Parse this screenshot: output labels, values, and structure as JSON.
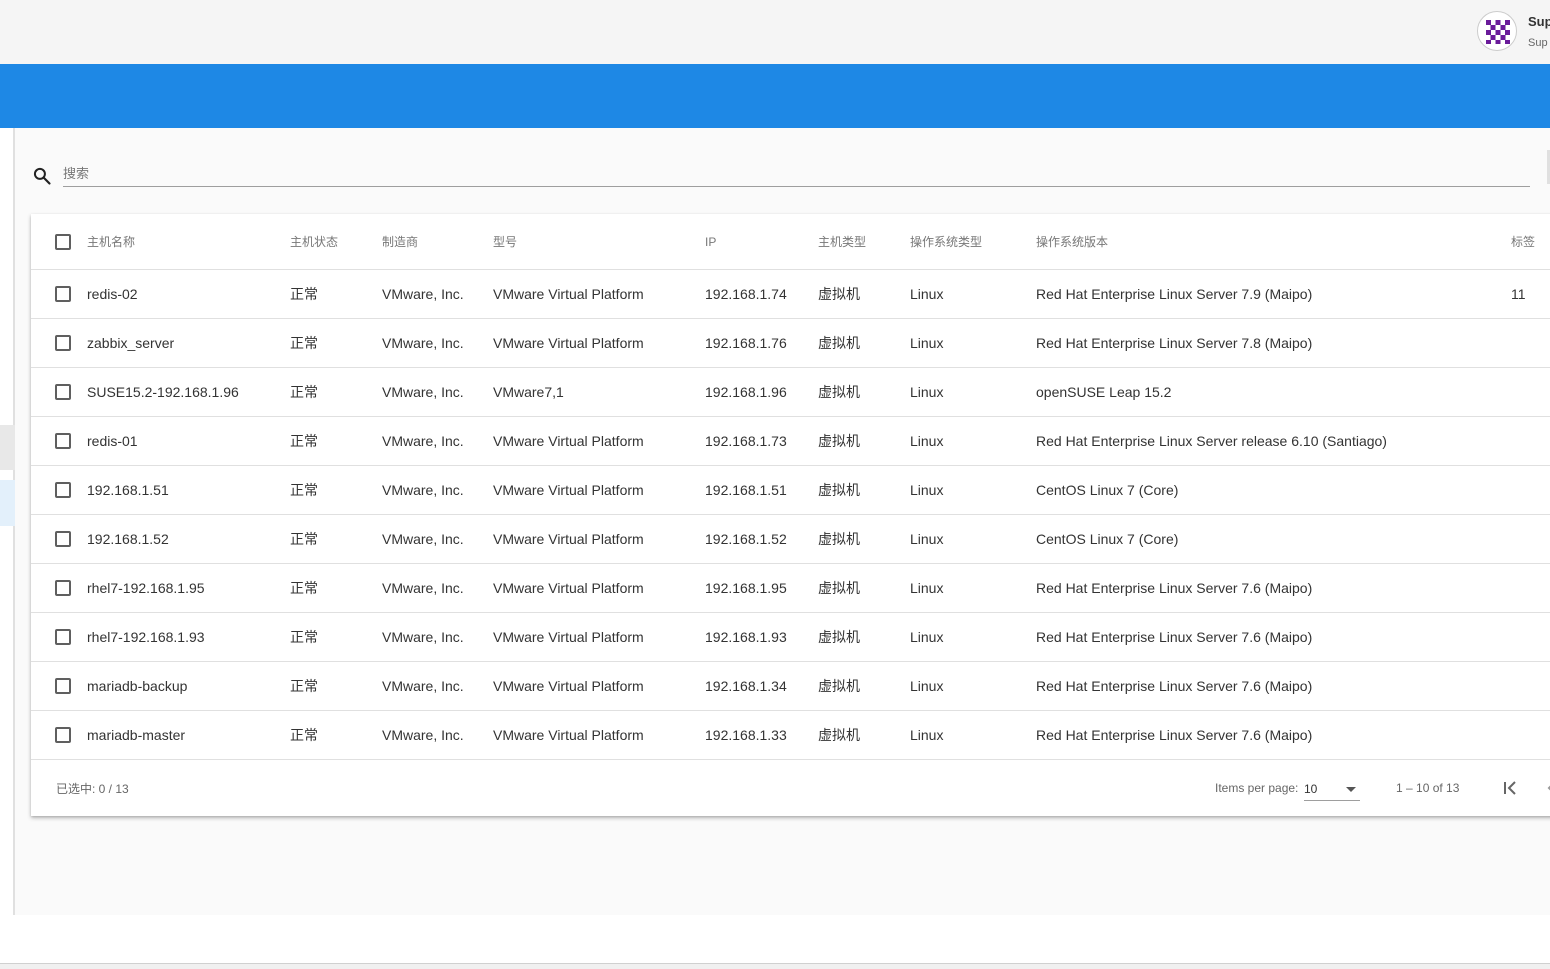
{
  "user": {
    "name": "Sup",
    "subtitle": "Sup"
  },
  "search": {
    "placeholder": "搜索",
    "value": ""
  },
  "table": {
    "columns": {
      "name": "主机名称",
      "status": "主机状态",
      "vendor": "制造商",
      "model": "型号",
      "ip": "IP",
      "type": "主机类型",
      "os": "操作系统类型",
      "os_version": "操作系统版本",
      "tag": "标签"
    },
    "rows": [
      {
        "name": "redis-02",
        "status": "正常",
        "vendor": "VMware, Inc.",
        "model": "VMware Virtual Platform",
        "ip": "192.168.1.74",
        "type": "虚拟机",
        "os": "Linux",
        "os_version": "Red Hat Enterprise Linux Server 7.9 (Maipo)",
        "tag": "11"
      },
      {
        "name": "zabbix_server",
        "status": "正常",
        "vendor": "VMware, Inc.",
        "model": "VMware Virtual Platform",
        "ip": "192.168.1.76",
        "type": "虚拟机",
        "os": "Linux",
        "os_version": "Red Hat Enterprise Linux Server 7.8 (Maipo)",
        "tag": ""
      },
      {
        "name": "SUSE15.2-192.168.1.96",
        "status": "正常",
        "vendor": "VMware, Inc.",
        "model": "VMware7,1",
        "ip": "192.168.1.96",
        "type": "虚拟机",
        "os": "Linux",
        "os_version": "openSUSE Leap 15.2",
        "tag": ""
      },
      {
        "name": "redis-01",
        "status": "正常",
        "vendor": "VMware, Inc.",
        "model": "VMware Virtual Platform",
        "ip": "192.168.1.73",
        "type": "虚拟机",
        "os": "Linux",
        "os_version": "Red Hat Enterprise Linux Server release 6.10 (Santiago)",
        "tag": ""
      },
      {
        "name": "192.168.1.51",
        "status": "正常",
        "vendor": "VMware, Inc.",
        "model": "VMware Virtual Platform",
        "ip": "192.168.1.51",
        "type": "虚拟机",
        "os": "Linux",
        "os_version": "CentOS Linux 7 (Core)",
        "tag": ""
      },
      {
        "name": "192.168.1.52",
        "status": "正常",
        "vendor": "VMware, Inc.",
        "model": "VMware Virtual Platform",
        "ip": "192.168.1.52",
        "type": "虚拟机",
        "os": "Linux",
        "os_version": "CentOS Linux 7 (Core)",
        "tag": ""
      },
      {
        "name": "rhel7-192.168.1.95",
        "status": "正常",
        "vendor": "VMware, Inc.",
        "model": "VMware Virtual Platform",
        "ip": "192.168.1.95",
        "type": "虚拟机",
        "os": "Linux",
        "os_version": "Red Hat Enterprise Linux Server 7.6 (Maipo)",
        "tag": ""
      },
      {
        "name": "rhel7-192.168.1.93",
        "status": "正常",
        "vendor": "VMware, Inc.",
        "model": "VMware Virtual Platform",
        "ip": "192.168.1.93",
        "type": "虚拟机",
        "os": "Linux",
        "os_version": "Red Hat Enterprise Linux Server 7.6 (Maipo)",
        "tag": ""
      },
      {
        "name": "mariadb-backup",
        "status": "正常",
        "vendor": "VMware, Inc.",
        "model": "VMware Virtual Platform",
        "ip": "192.168.1.34",
        "type": "虚拟机",
        "os": "Linux",
        "os_version": "Red Hat Enterprise Linux Server 7.6 (Maipo)",
        "tag": ""
      },
      {
        "name": "mariadb-master",
        "status": "正常",
        "vendor": "VMware, Inc.",
        "model": "VMware Virtual Platform",
        "ip": "192.168.1.33",
        "type": "虚拟机",
        "os": "Linux",
        "os_version": "Red Hat Enterprise Linux Server 7.6 (Maipo)",
        "tag": ""
      }
    ]
  },
  "footer": {
    "selected": "已选中: 0 / 13",
    "items_per_page_label": "Items per page:",
    "items_per_page_value": "10",
    "range": "1 – 10 of 13"
  },
  "icons": {
    "search": "search-icon",
    "avatar": "identicon",
    "first_page": "first-page-icon",
    "prev_page": "chevron-left-icon",
    "dropdown": "caret-down-icon"
  },
  "colors": {
    "primary": "#1e88e5",
    "avatar": "#6a1b9a"
  }
}
